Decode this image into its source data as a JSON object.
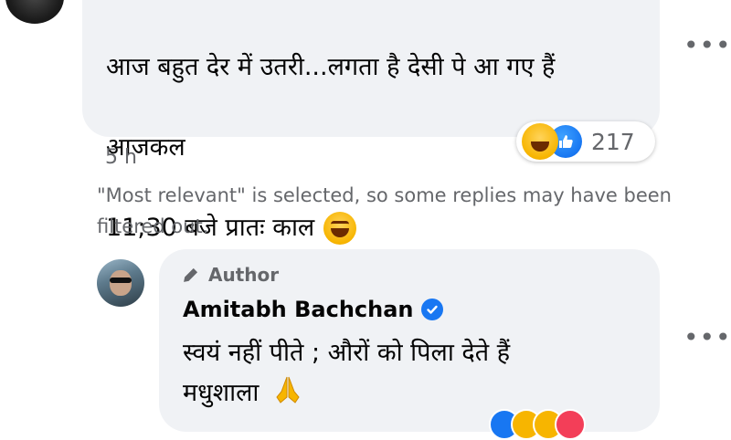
{
  "comment": {
    "text_line1": "आज बहुत देर में उतरी...लगता है देसी पे आ गए हैं",
    "text_line2": "आजकल",
    "text_line3": "11;30 बजे प्रातः काल",
    "timestamp": "5 h",
    "reaction_count": "217",
    "reactions": [
      "haha",
      "like"
    ],
    "more_label": "•••"
  },
  "notice": {
    "text": "\"Most relevant\" is selected, so some replies may have been filtered out."
  },
  "reply": {
    "author_badge": "Author",
    "author_name": "Amitabh Bachchan",
    "verified": true,
    "text_line1": "स्वयं नहीं पीते ; औरों को पिला देते हैं",
    "text_line2": "मधुशाला",
    "more_label": "•••"
  },
  "colors": {
    "bubble": "#f0f2f5",
    "secondary_text": "#65676b",
    "accent_blue": "#1877f2",
    "emoji_yellow": "#f7b500"
  }
}
